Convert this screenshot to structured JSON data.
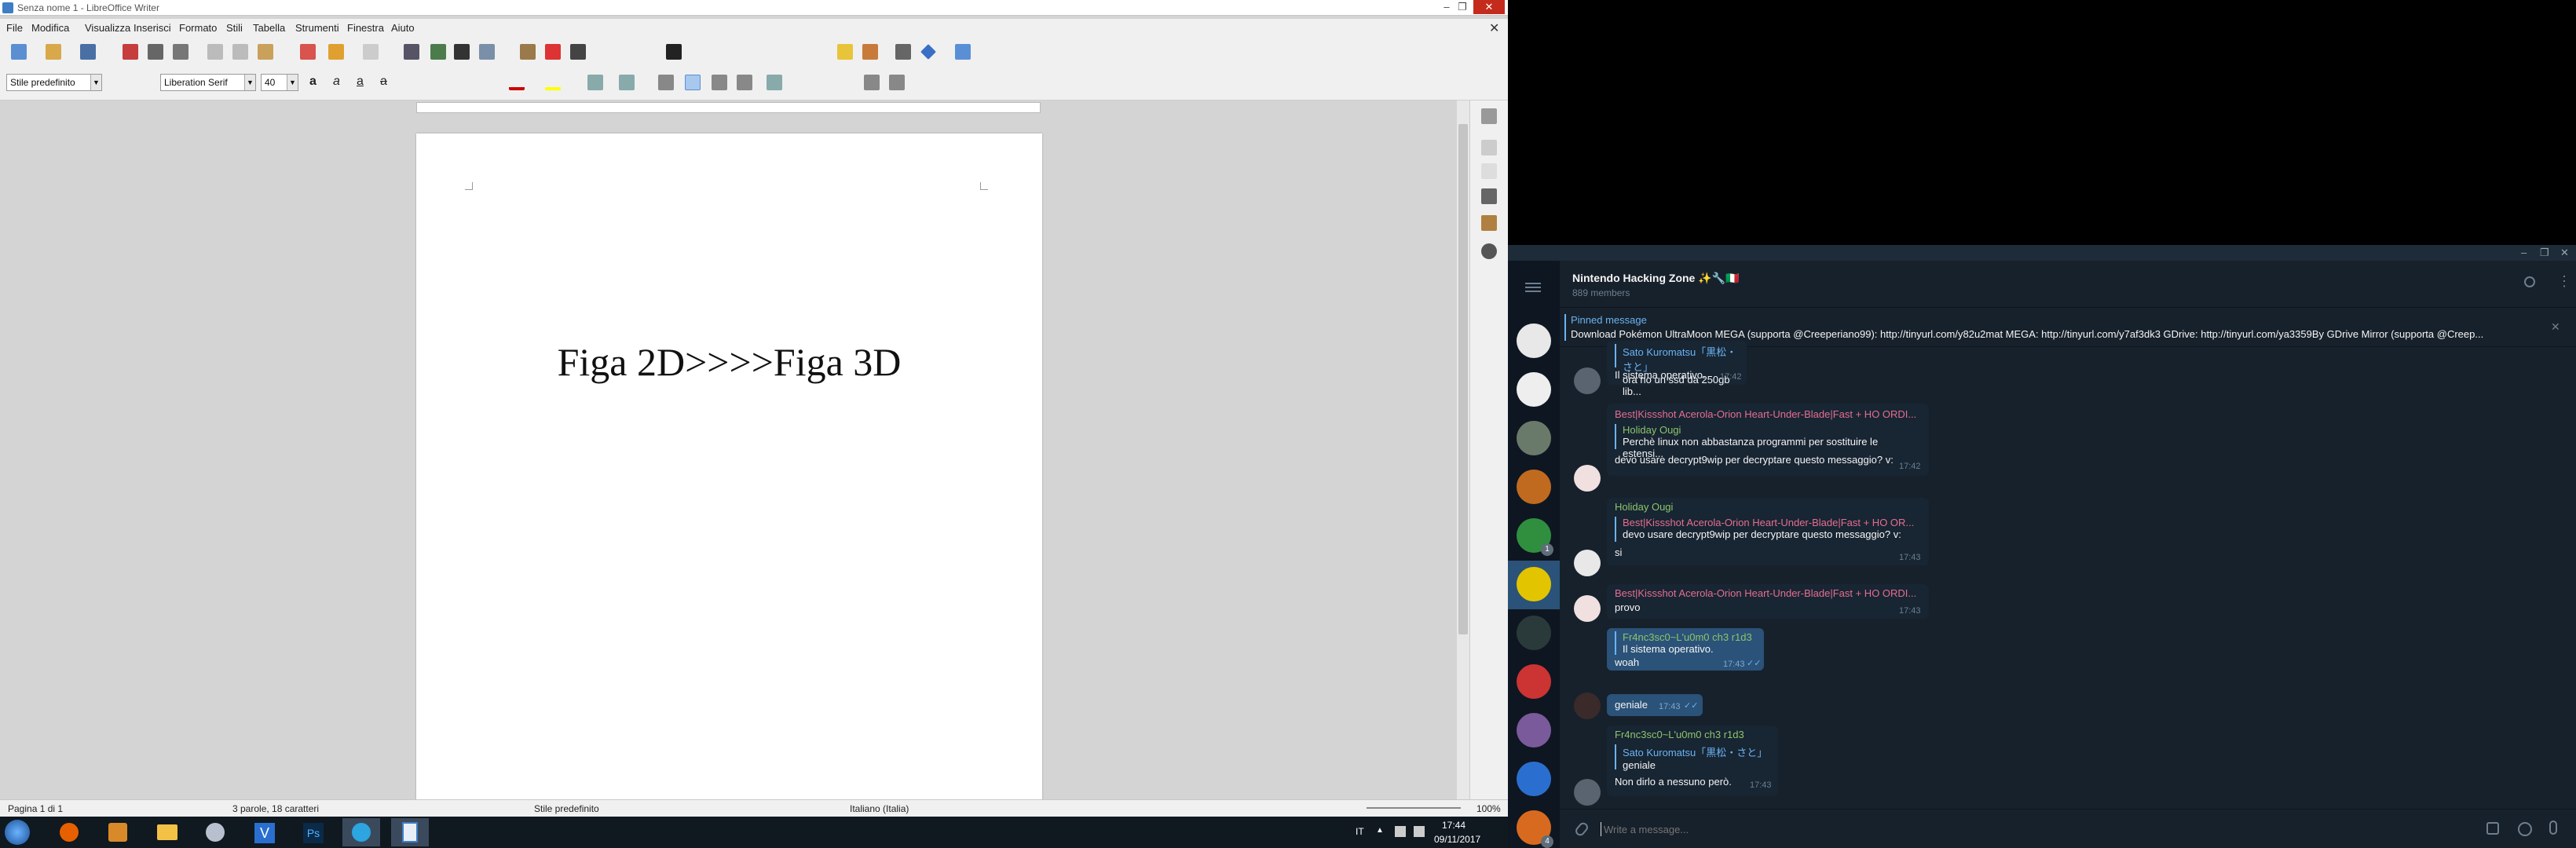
{
  "writer": {
    "title": "Senza nome 1 - LibreOffice Writer",
    "menu": [
      "File",
      "Modifica",
      "Visualizza",
      "Inserisci",
      "Formato",
      "Stili",
      "Tabella",
      "Strumenti",
      "Finestra",
      "Aiuto"
    ],
    "paragraph_style": "Stile predefinito",
    "font_name": "Liberation Serif",
    "font_size": "40",
    "doc_text": "Figa 2D>>>>Figa 3D",
    "status": {
      "page": "Pagina 1 di 1",
      "words": "3 parole, 18 caratteri",
      "style": "Stile predefinito",
      "language": "Italiano (Italia)",
      "zoom": "100%"
    }
  },
  "taskbar": {
    "lang": "IT",
    "time": "17:44",
    "date": "09/11/2017"
  },
  "telegram": {
    "chat_title": "Nintendo Hacking Zone ✨🔧🇮🇹",
    "members": "889 members",
    "pinned_label": "Pinned message",
    "pinned_text": "Download Pokémon UltraMoon  MEGA (supporta @Creeperiano99): http://tinyurl.com/y82u2mat MEGA: http://tinyurl.com/y7af3dk3  GDrive: http://tinyurl.com/ya3359By GDrive Mirror (supporta @Creep...",
    "input_placeholder": "Write a message...",
    "messages": [
      {
        "quote_name": "Sato Kuromatsu「黒松・さと」",
        "quote_text": "ora ho un ssd da 250gb lib...",
        "text": "Il sistema operativo.",
        "time": "17:42"
      },
      {
        "sender": "Best|Kissshot Acerola-Orion Heart-Under-Blade|Fast + HO ORDI...",
        "quote_name": "Holiday Ougi",
        "quote_text": "Perchè linux non abbastanza programmi per sostituire le estensi...",
        "text": "devo usare decrypt9wip per decryptare questo messaggio? v:",
        "time": "17:42"
      },
      {
        "sender": "Holiday Ougi",
        "quote_name": "Best|Kissshot Acerola-Orion Heart-Under-Blade|Fast + HO OR...",
        "quote_text": "devo usare decrypt9wip per decryptare questo messaggio? v:",
        "text": "si",
        "time": "17:43"
      },
      {
        "sender": "Best|Kissshot Acerola-Orion Heart-Under-Blade|Fast + HO ORDI...",
        "text": "provo",
        "time": "17:43"
      },
      {
        "quote_name": "Fr4nc3sc0~L'u0m0 ch3 r1d3",
        "quote_text": "Il sistema operativo.",
        "text": "woah",
        "time": "17:43"
      },
      {
        "text": "geniale",
        "time": "17:43"
      },
      {
        "sender": "Fr4nc3sc0~L'u0m0 ch3 r1d3",
        "quote_name": "Sato Kuromatsu「黒松・さと」",
        "quote_text": "geniale",
        "text": "Non dirlo a nessuno però.",
        "time": "17:43"
      }
    ],
    "unread_badges": [
      "1",
      "4"
    ]
  },
  "colors": {
    "tg_bg": "#17212b",
    "tg_out": "#2b5278",
    "tg_accent": "#6ab3f3",
    "pink_name": "#e56e8f",
    "green_name": "#8dc46b"
  }
}
